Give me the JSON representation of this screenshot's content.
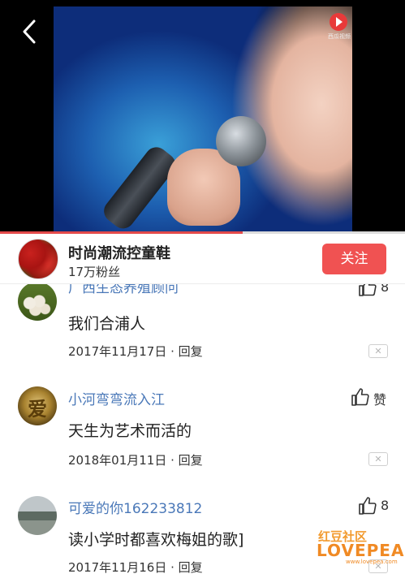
{
  "video": {
    "source_label": "西瓜视频",
    "progress_percent": 60
  },
  "author": {
    "name": "时尚潮流控童鞋",
    "fans": "17万粉丝",
    "follow_label": "关注"
  },
  "comments": [
    {
      "name": "广西生态养殖顾问",
      "text": "我们合浦人",
      "date": "2017年11月17日",
      "separator": " · ",
      "reply_label": "回复",
      "like_count": "8",
      "close_glyph": "✕"
    },
    {
      "name": "小河弯弯流入江",
      "text": "天生为艺术而活的",
      "date": "2018年01月11日",
      "separator": " · ",
      "reply_label": "回复",
      "like_count": "赞",
      "close_glyph": "✕",
      "avatar_char": "爱"
    },
    {
      "name": "可爱的你162233812",
      "text": "读小学时都喜欢梅姐的歌]",
      "date": "2017年11月16日",
      "separator": " · ",
      "reply_label": "回复",
      "like_count": "8",
      "close_glyph": "✕"
    }
  ],
  "watermark": {
    "top": "红豆社区",
    "logo": "LOVEPEA",
    "url": "www.lovepea.com"
  },
  "icons": {
    "back": "back-arrow-icon",
    "like": "thumbs-up-icon",
    "close": "close-icon",
    "play": "play-icon"
  },
  "colors": {
    "accent": "#f05252",
    "username": "#4a78b8",
    "progress": "#e34a4a"
  }
}
